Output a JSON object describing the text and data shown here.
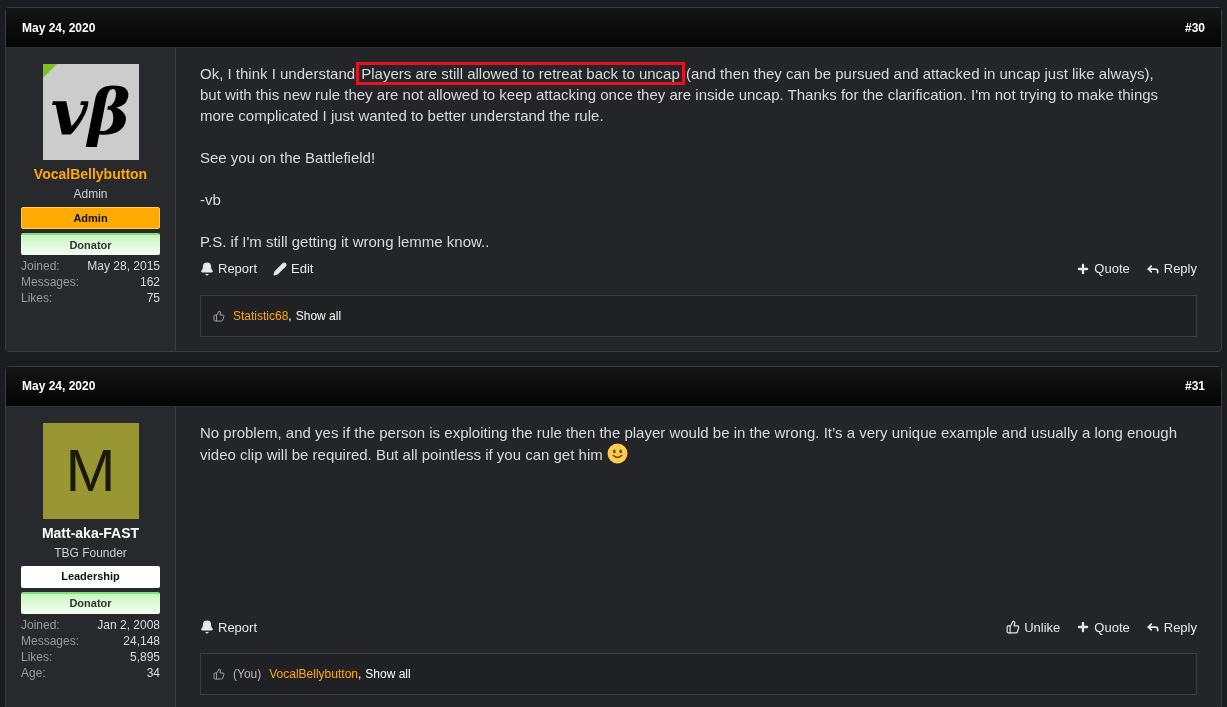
{
  "posts": [
    {
      "date": "May 24, 2020",
      "number": "#30",
      "user": {
        "avatar": {
          "kind": "image-text",
          "text": "vβ"
        },
        "online": true,
        "name": "VocalBellybutton",
        "staff": true,
        "title": "Admin",
        "banners": [
          {
            "label": "Admin",
            "kind": "admin"
          },
          {
            "label": "Donator",
            "kind": "donator"
          }
        ],
        "stats": [
          {
            "label": "Joined:",
            "value": "May 28, 2015"
          },
          {
            "label": "Messages:",
            "value": "162"
          },
          {
            "label": "Likes:",
            "value": "75"
          }
        ]
      },
      "paragraphs": [
        [
          {
            "kind": "text",
            "text": "Ok, I think I understand "
          },
          {
            "kind": "highlight",
            "text": "Players are still allowed to retreat back to uncap"
          },
          {
            "kind": "text",
            "text": " (and then they can be pursued and attacked in uncap just like always), but with this new rule they are not allowed to keep attacking once they are inside uncap. Thanks for the clarification. I'm not trying to make things more complicated I just wanted to better understand the rule."
          }
        ],
        [
          {
            "kind": "text",
            "text": "See you on the Battlefield!"
          }
        ],
        [
          {
            "kind": "text",
            "text": "-vb"
          }
        ],
        [
          {
            "kind": "text",
            "text": "P.S. if I'm still getting it wrong lemme know.."
          }
        ]
      ],
      "actions_left": [
        {
          "kind": "report",
          "label": "Report"
        },
        {
          "kind": "edit",
          "label": "Edit"
        }
      ],
      "actions_right": [
        {
          "kind": "quote",
          "label": "Quote"
        },
        {
          "kind": "reply",
          "label": "Reply"
        }
      ],
      "likes": {
        "users": [
          "Statistic68"
        ],
        "separator": ",",
        "show_all": "Show all"
      }
    },
    {
      "date": "May 24, 2020",
      "number": "#31",
      "user": {
        "avatar": {
          "kind": "letter",
          "text": "M"
        },
        "online": false,
        "name": "Matt-aka-FAST",
        "staff": false,
        "title": "TBG Founder",
        "banners": [
          {
            "label": "Leadership",
            "kind": "leadership"
          },
          {
            "label": "Donator",
            "kind": "donator"
          }
        ],
        "stats": [
          {
            "label": "Joined:",
            "value": "Jan 2, 2008"
          },
          {
            "label": "Messages:",
            "value": "24,148"
          },
          {
            "label": "Likes:",
            "value": "5,895"
          },
          {
            "label": "Age:",
            "value": "34"
          }
        ]
      },
      "paragraphs": [
        [
          {
            "kind": "text",
            "text": "No problem, and yes if the person is exploiting the rule then the player would be in the wrong. It’s a very unique example and usually a long enough video clip will be required. But all pointless if you can get him "
          },
          {
            "kind": "smiley"
          }
        ]
      ],
      "actions_left": [
        {
          "kind": "report",
          "label": "Report"
        }
      ],
      "actions_right": [
        {
          "kind": "unlike",
          "label": "Unlike"
        },
        {
          "kind": "quote",
          "label": "Quote"
        },
        {
          "kind": "reply",
          "label": "Reply"
        }
      ],
      "likes": {
        "you": "(You)",
        "users": [
          "VocalBellybutton"
        ],
        "separator": ",",
        "show_all": "Show all"
      }
    }
  ]
}
